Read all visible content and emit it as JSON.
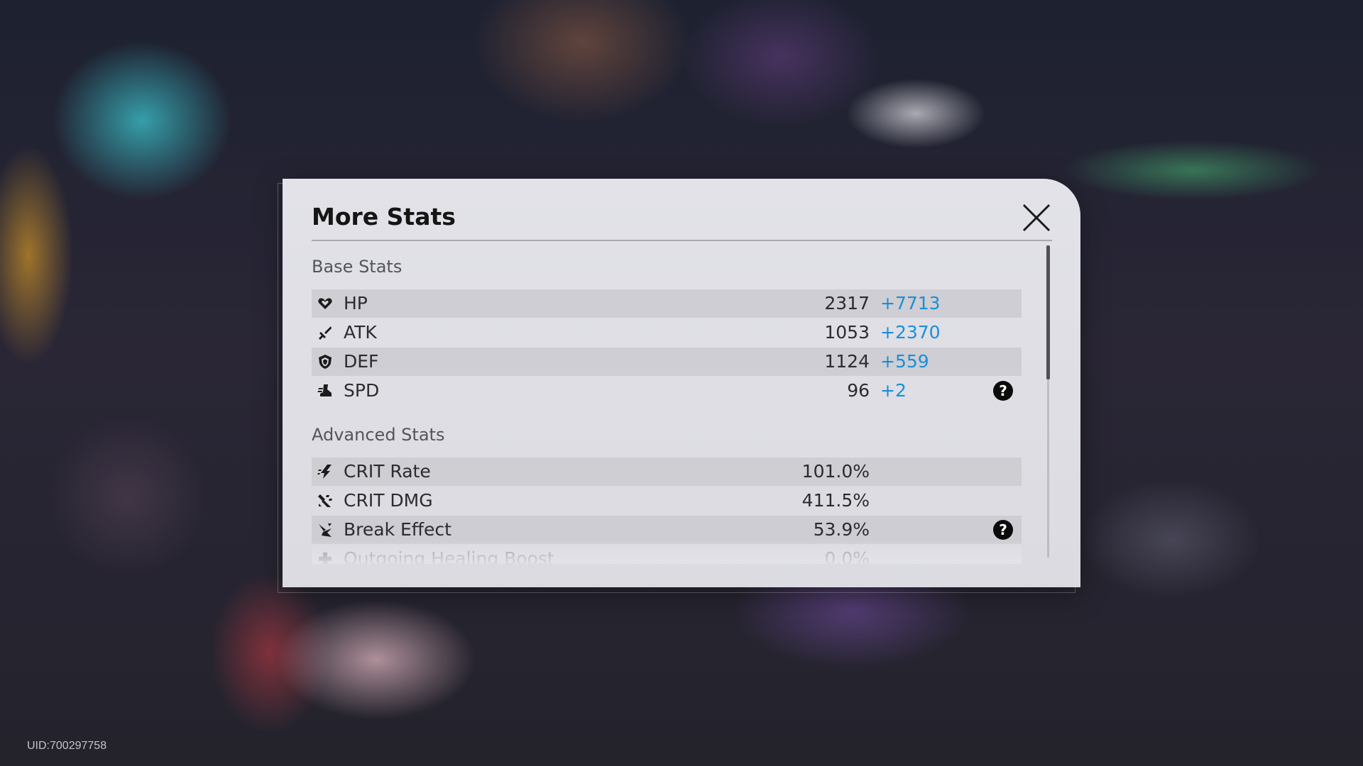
{
  "uid_text": "UID:700297758",
  "panel": {
    "title": "More Stats",
    "close_icon": "close-x-icon"
  },
  "sections": [
    {
      "header": "Base Stats",
      "rows": [
        {
          "name": "HP",
          "icon": "hp-heart-icon",
          "value": "2317",
          "bonus": "+7713",
          "help": false
        },
        {
          "name": "ATK",
          "icon": "atk-sword-icon",
          "value": "1053",
          "bonus": "+2370",
          "help": false
        },
        {
          "name": "DEF",
          "icon": "def-shield-icon",
          "value": "1124",
          "bonus": "+559",
          "help": false
        },
        {
          "name": "SPD",
          "icon": "spd-boot-icon",
          "value": "96",
          "bonus": "+2",
          "help": true
        }
      ]
    },
    {
      "header": "Advanced Stats",
      "rows": [
        {
          "name": "CRIT Rate",
          "icon": "crit-rate-icon",
          "value": "101.0%",
          "help": false
        },
        {
          "name": "CRIT DMG",
          "icon": "crit-dmg-icon",
          "value": "411.5%",
          "help": false
        },
        {
          "name": "Break Effect",
          "icon": "break-effect-icon",
          "value": "53.9%",
          "help": true
        },
        {
          "name": "Outgoing Healing Boost",
          "icon": "healing-cross-icon",
          "value": "0.0%",
          "help": false
        }
      ]
    }
  ],
  "help_label": "?",
  "colors": {
    "bonus": "#1a8fd6",
    "panel_bg": "#e4e4ea",
    "row_shade": "#c8c8ce",
    "title": "#151515"
  },
  "scroll": {
    "thumb_fraction": 0.43,
    "position_fraction": 0.0
  }
}
